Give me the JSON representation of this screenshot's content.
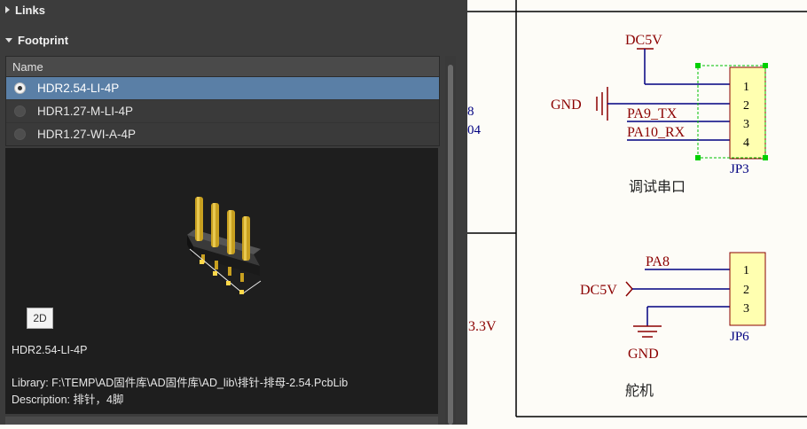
{
  "panel": {
    "links_section": "Links",
    "footprint_section": "Footprint",
    "list_header": "Name",
    "footprints": [
      {
        "name": "HDR2.54-LI-4P",
        "selected": true
      },
      {
        "name": "HDR1.27-M-LI-4P",
        "selected": false
      },
      {
        "name": "HDR1.27-WI-A-4P",
        "selected": false
      }
    ],
    "view_mode_button": "2D",
    "selected_name": "HDR2.54-LI-4P",
    "library": "Library: F:\\TEMP\\AD固件库\\AD固件库\\AD_lib\\排针-排母-2.54.PcbLib",
    "description": "Description: 排针，4脚"
  },
  "schematic": {
    "edge_text_1": "8",
    "edge_text_2": "04",
    "edge_text_3": "3.3V",
    "jp3": {
      "designator": "JP3",
      "pins": [
        "1",
        "2",
        "3",
        "4"
      ],
      "power": "DC5V",
      "gnd": "GND",
      "net1": "PA9_TX",
      "net2": "PA10_RX",
      "comment": "调试串口"
    },
    "jp6": {
      "designator": "JP6",
      "pins": [
        "1",
        "2",
        "3"
      ],
      "net": "PA8",
      "power": "DC5V",
      "gnd": "GND",
      "comment": "舵机"
    },
    "colors": {
      "wire": "#000080",
      "net_label": "#8b0000",
      "part_fill": "#ffffb0",
      "part_border": "#8b0000",
      "designator": "#000080",
      "selection": "#00c000",
      "frame": "#000000"
    }
  }
}
